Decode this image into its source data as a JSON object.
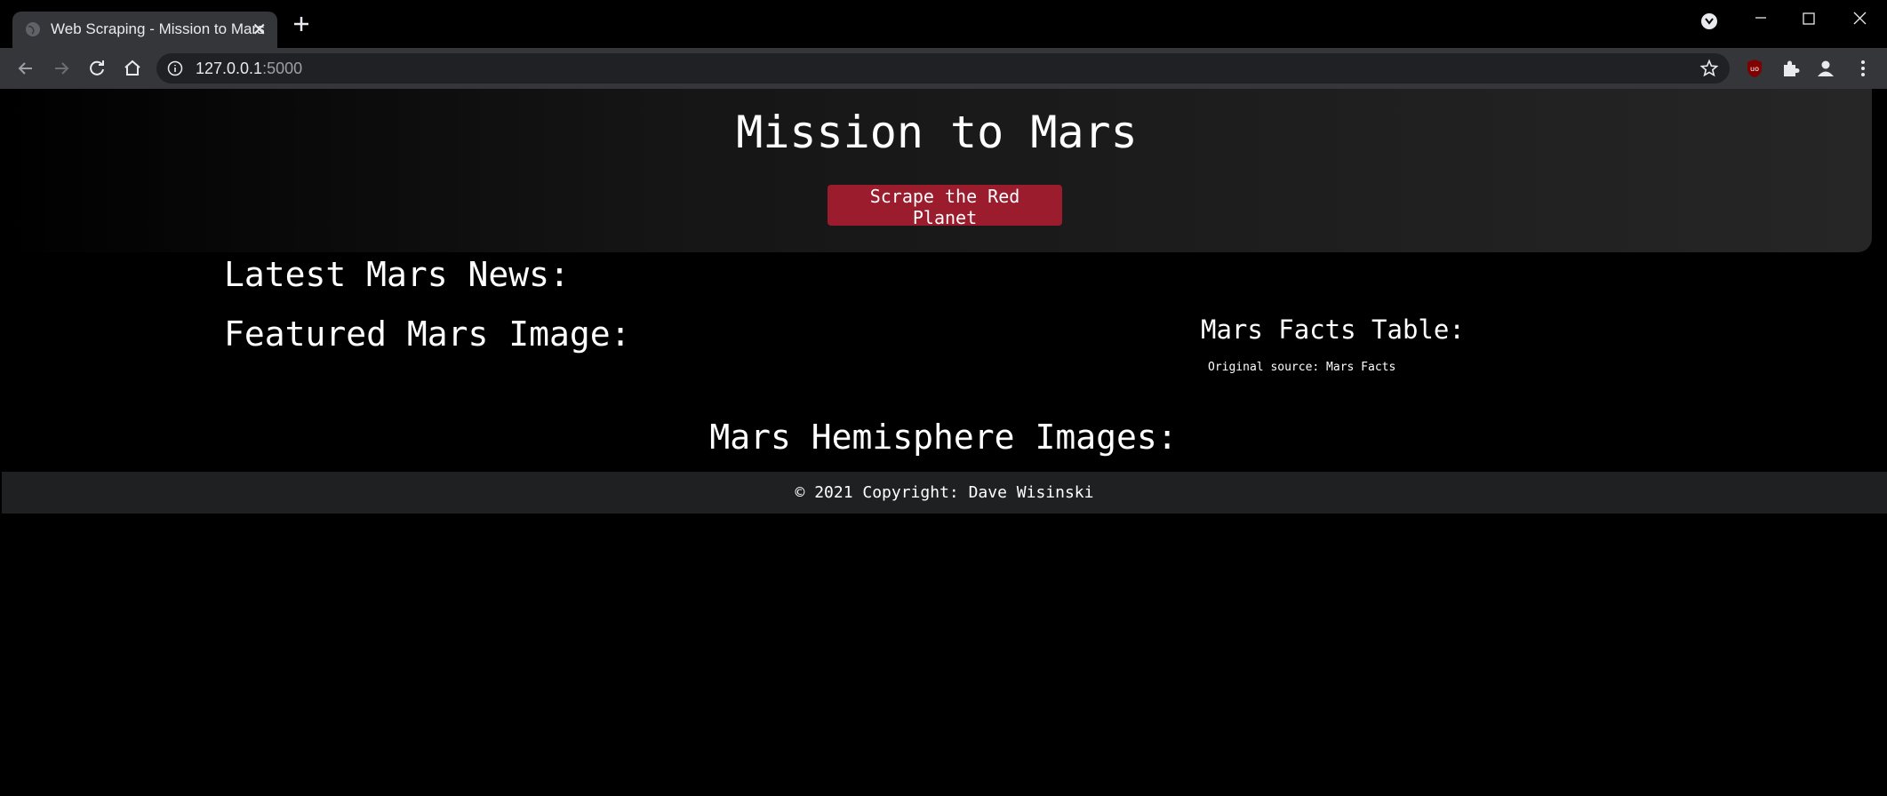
{
  "browser": {
    "tab_title": "Web Scraping - Mission to Mars",
    "tab_close": "✕",
    "url_host": "127.0.0.1",
    "url_port": ":5000"
  },
  "page": {
    "title": "Mission to Mars",
    "scrape_button": "Scrape the Red Planet",
    "news_heading": "Latest Mars News:",
    "image_heading": "Featured Mars Image:",
    "facts_heading": "Mars Facts Table:",
    "facts_source": "Original source: Mars Facts",
    "hemisphere_heading": "Mars Hemisphere Images:",
    "footer": "© 2021 Copyright: Dave Wisinski"
  },
  "colors": {
    "button_bg": "#9b1c2c",
    "footer_bg": "#1f2022",
    "toolbar_bg": "#35363a"
  }
}
